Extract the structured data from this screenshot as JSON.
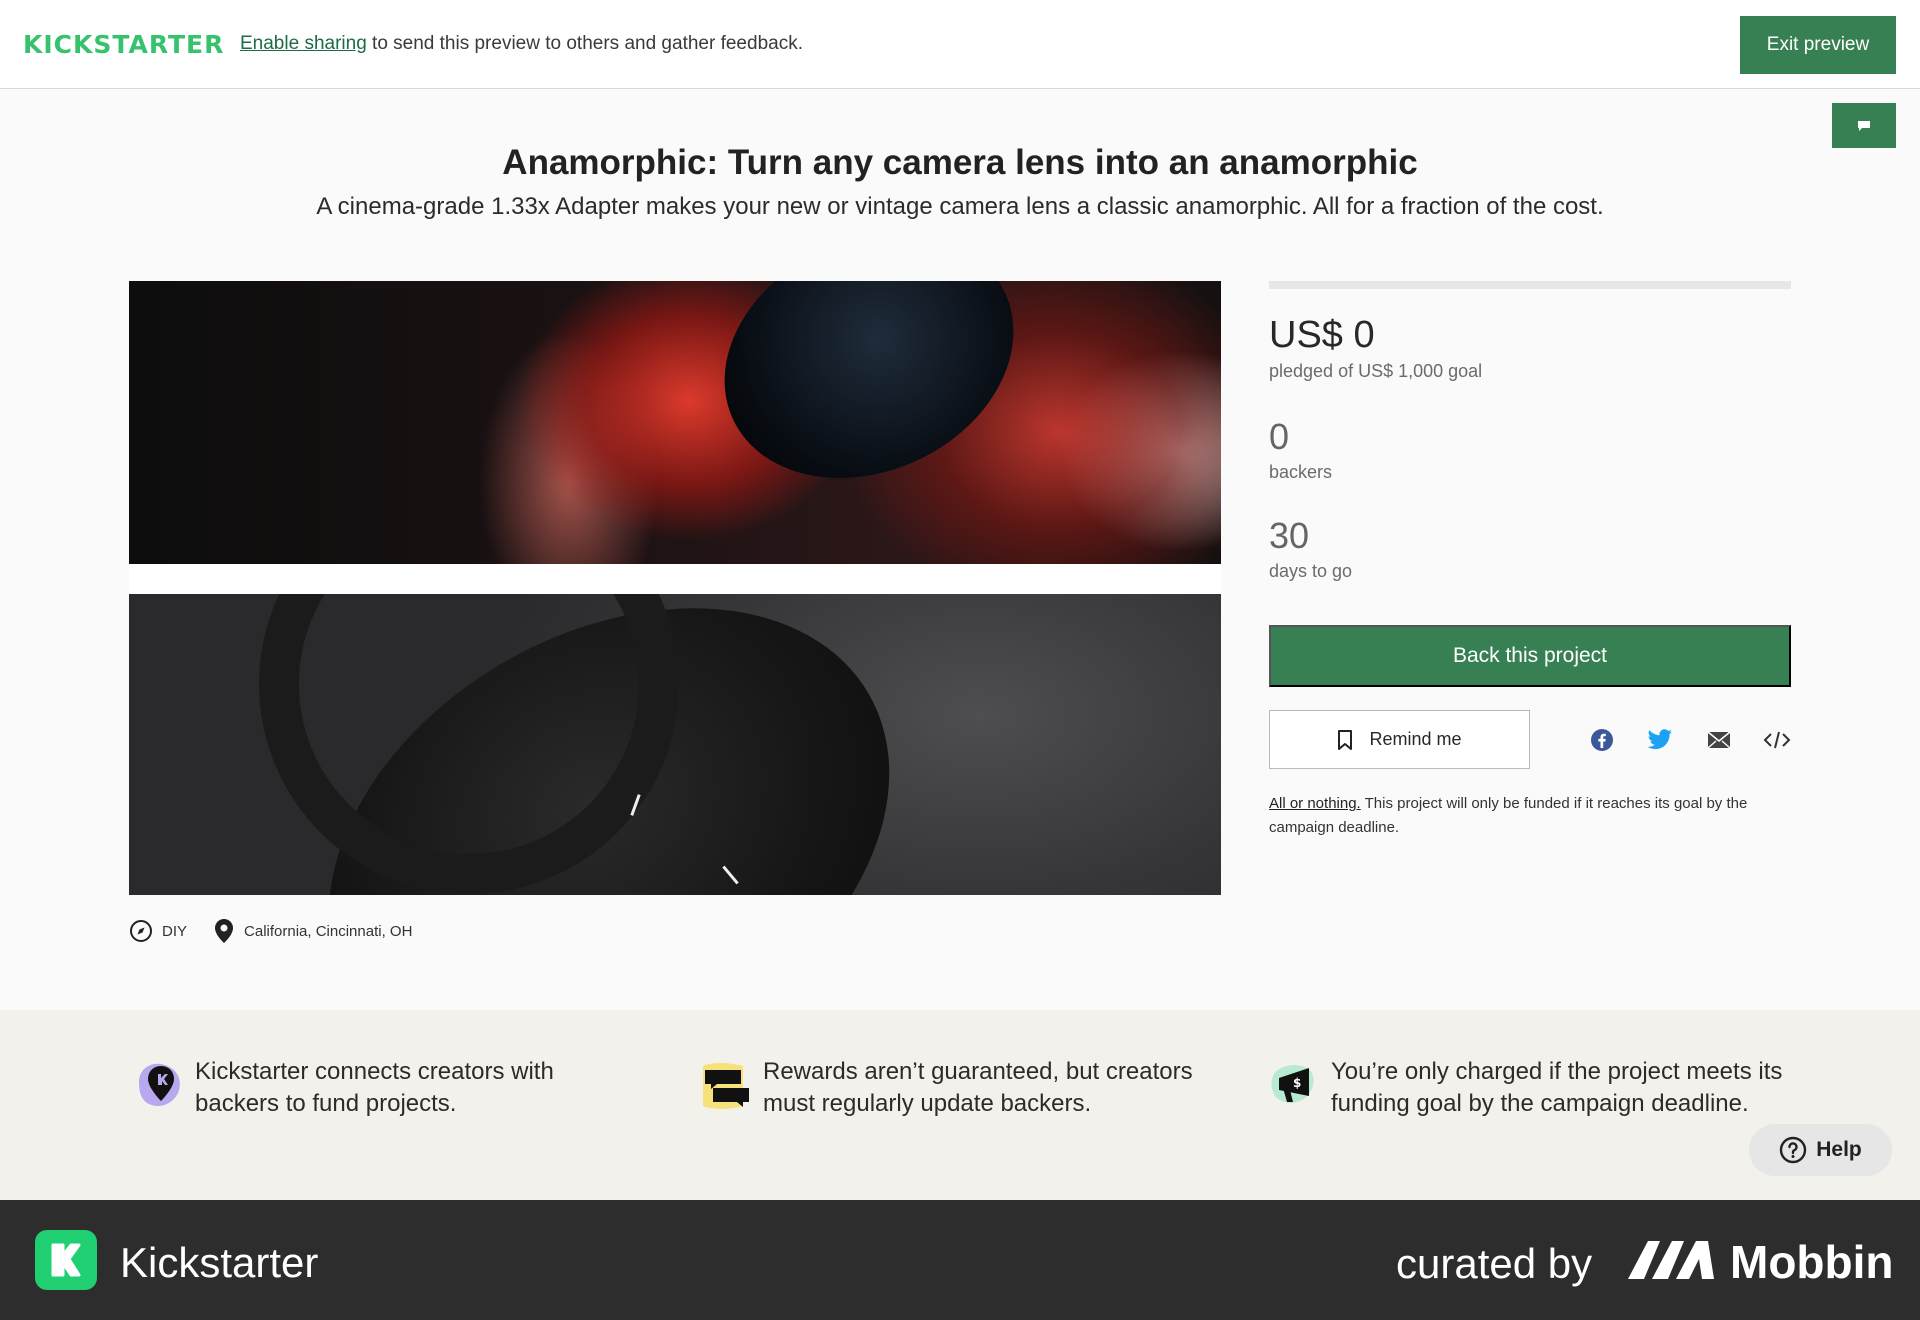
{
  "topbar": {
    "logo": "KICKSTARTER",
    "enable_link": "Enable sharing",
    "message": " to send this preview to others and gather feedback.",
    "exit_label": "Exit preview"
  },
  "project": {
    "title": "Anamorphic: Turn any camera lens into an anamorphic",
    "subtitle": "A cinema-grade 1.33x Adapter makes your new or vintage camera lens a classic anamorphic. All for a fraction of the cost.",
    "category": "DIY",
    "location": "California, Cincinnati, OH"
  },
  "stats": {
    "funded_fraction": 0,
    "pledged": "US$ 0",
    "pledged_label": "pledged of US$ 1,000 goal",
    "backers": "0",
    "backers_label": "backers",
    "days": "30",
    "days_label": "days to go"
  },
  "actions": {
    "back_label": "Back this project",
    "remind_label": "Remind me",
    "share_icons": [
      "facebook-icon",
      "twitter-icon",
      "email-icon",
      "embed-icon"
    ],
    "aon_link": "All or nothing.",
    "aon_text": " This project will only be funded if it reaches its goal by the campaign deadline."
  },
  "info": [
    {
      "icon": "map-pin-blob-icon",
      "text": "Kickstarter connects creators with backers to fund projects."
    },
    {
      "icon": "chat-bubbles-icon",
      "text": "Rewards aren’t guaranteed, but creators must regularly update backers."
    },
    {
      "icon": "money-megaphone-icon",
      "text": "You’re only charged if the project meets its funding goal by the campaign deadline."
    }
  ],
  "help_label": "Help",
  "footer": {
    "app_name": "Kickstarter",
    "curated": "curated by",
    "brand": "Mobbin"
  },
  "colors": {
    "brand_green": "#378053",
    "kickstarter_green": "#37c26d"
  }
}
